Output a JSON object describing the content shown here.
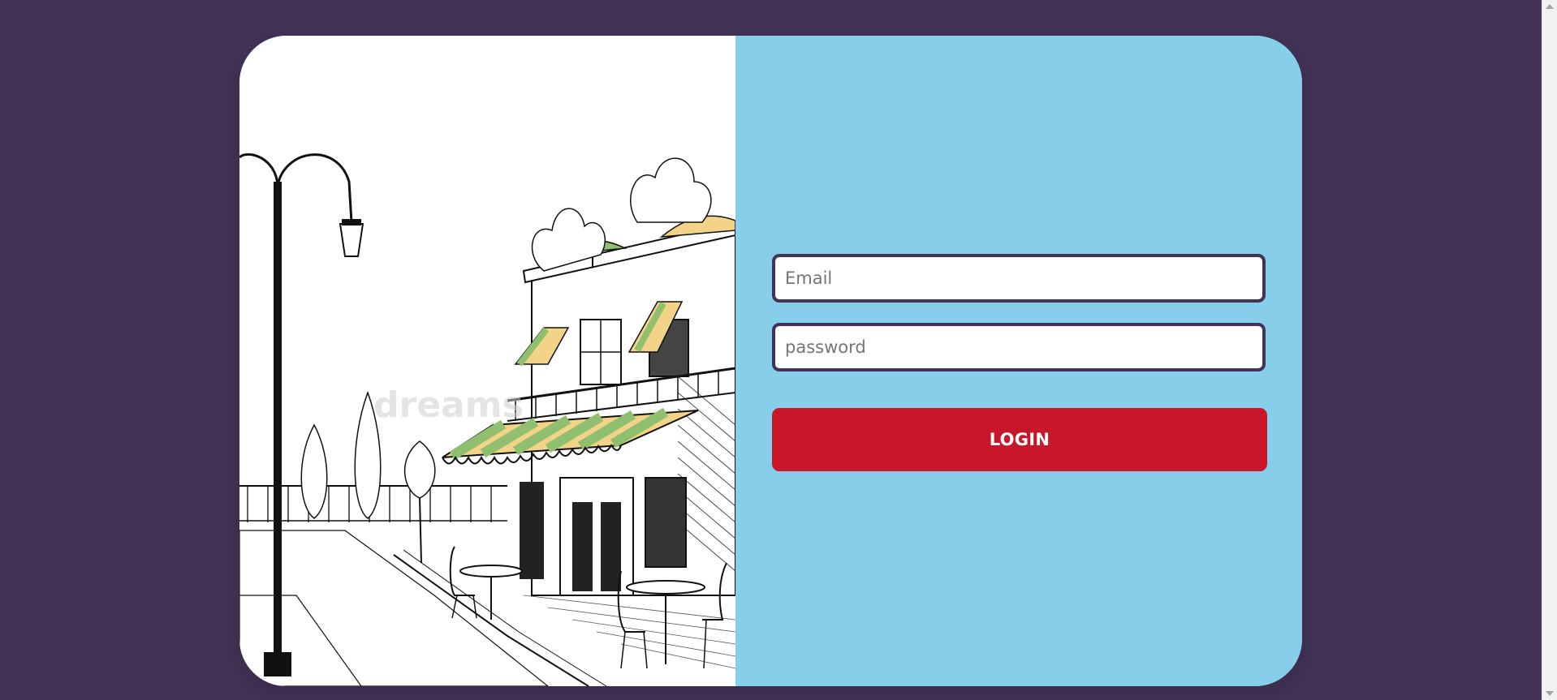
{
  "login": {
    "email_placeholder": "Email",
    "password_placeholder": "password",
    "button_label": "LOGIN"
  },
  "illustration": {
    "watermark": "dreams"
  },
  "icons": {
    "scroll_up": "scroll-up-arrow-icon",
    "scroll_down": "scroll-down-arrow-icon"
  },
  "colors": {
    "background": "#433357",
    "panel": "#87ceeb",
    "button": "#c8172b",
    "field_border": "#433357"
  }
}
